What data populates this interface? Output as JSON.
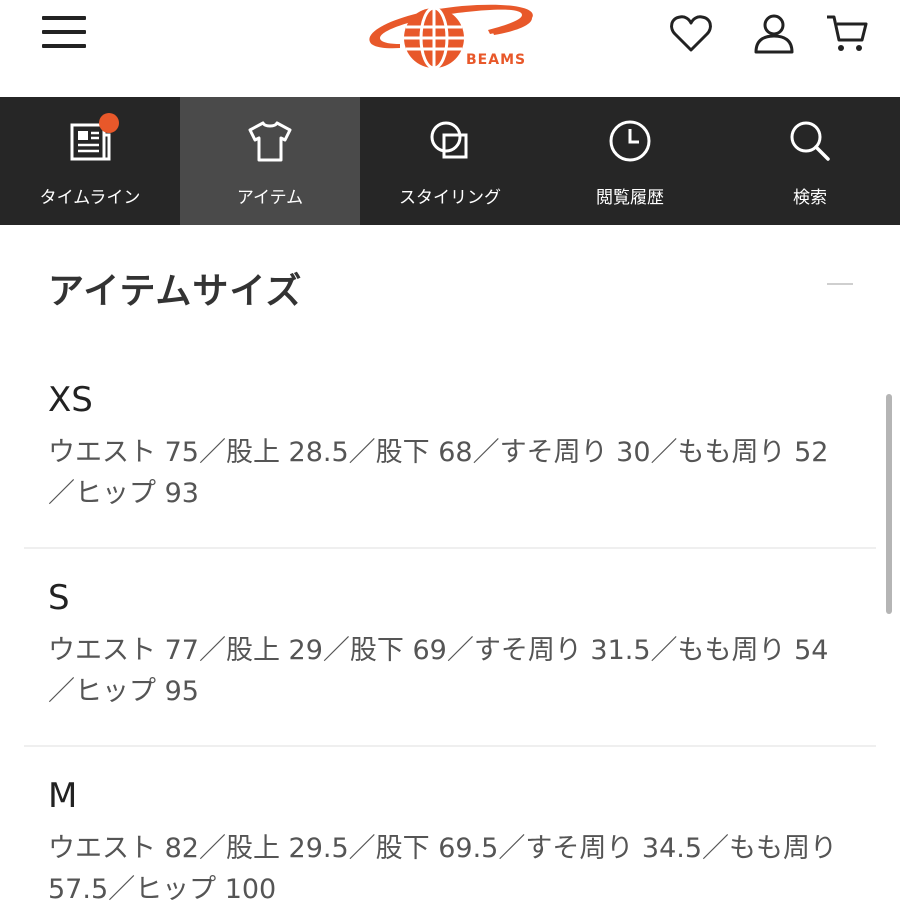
{
  "header": {
    "logo_text": "BEAMS",
    "icons": [
      "menu-icon",
      "heart-icon",
      "user-icon",
      "cart-icon"
    ]
  },
  "tabs": [
    {
      "label": "タイムライン",
      "icon": "timeline-icon",
      "badge": true
    },
    {
      "label": "アイテム",
      "icon": "tshirt-icon",
      "active": true
    },
    {
      "label": "スタイリング",
      "icon": "styling-icon"
    },
    {
      "label": "閲覧履歴",
      "icon": "clock-icon"
    },
    {
      "label": "検索",
      "icon": "search-icon"
    }
  ],
  "section": {
    "title": "アイテムサイズ"
  },
  "sizes": [
    {
      "name": "XS",
      "line1": "ウエスト 75／股上 28.5／股下 68／すそ周り 30／もも周り 52",
      "line2": "／ヒップ 93"
    },
    {
      "name": "S",
      "line1": "ウエスト 77／股上 29／股下 69／すそ周り 31.5／もも周り 54",
      "line2": "／ヒップ 95"
    },
    {
      "name": "M",
      "line1": "ウエスト 82／股上 29.5／股下 69.5／すそ周り 34.5／もも周り",
      "line2": "57.5／ヒップ 100"
    }
  ],
  "colors": {
    "brand": "#e8582a",
    "tabbar_bg": "#262626",
    "tab_active_bg": "#4a4a4a"
  }
}
